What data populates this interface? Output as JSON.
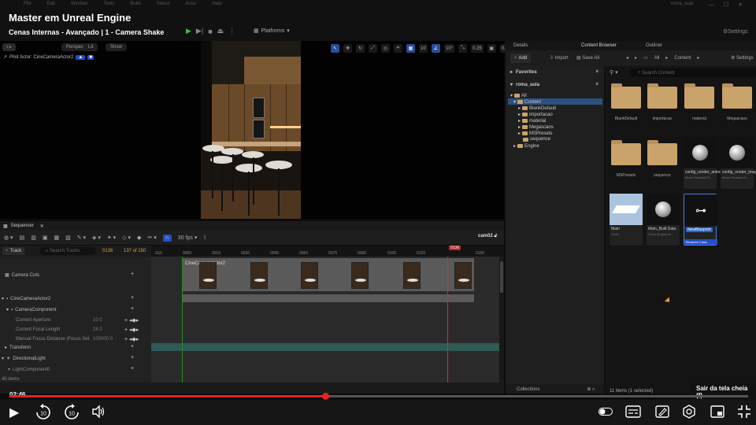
{
  "menu": [
    "File",
    "Edit",
    "Window",
    "Tools",
    "Build",
    "Select",
    "Actor",
    "Help"
  ],
  "project_name": "roma_aula",
  "course_title": "Master em Unreal Engine",
  "lesson_title": "Cenas Internas - Avançado | 1 - Camera Shake",
  "platforms_label": "Platforms",
  "settings_label": "Settings",
  "viewport": {
    "perspective": "Perspective",
    "lit": "Lit",
    "show": "Show",
    "pilot_label": "Pilot Actor: CineCameraActor2",
    "snap_grid": "10",
    "snap_angle": "10°",
    "snap_scale": "0.25",
    "camera_speed": "0.1"
  },
  "sequencer": {
    "tab": "Sequencer",
    "fps": "30 fps",
    "camera_name": "cam02",
    "track_button": "Track",
    "search_placeholder": "Search Tracks",
    "current_frame": "0136",
    "frame_total": "137 of 150",
    "ruler_ticks": [
      "-015",
      "0000",
      "0015",
      "0030",
      "0045",
      "0060",
      "0075",
      "0090",
      "0105",
      "0120",
      "0150"
    ],
    "playhead": "0136",
    "tracks": {
      "camera_cuts": "Camera Cuts",
      "actor": "CineCameraActor2",
      "component": "CameraComponent",
      "aperture": "Current Aperture",
      "aperture_val": "10.0",
      "focal": "Current Focal Length",
      "focal_val": "24.0",
      "focus": "Manual Focus Distance (Focus Set",
      "focus_val": "100000.0",
      "transform": "Transform",
      "light": "DirectionalLight",
      "light_comp": "LightComponent0",
      "items": "40 items"
    },
    "cut_clip_label": "CineCameraActor2"
  },
  "right_tabs": [
    "Details",
    "Content Browser",
    "Outliner"
  ],
  "content_browser": {
    "add": "Add",
    "import": "Import",
    "save_all": "Save All",
    "breadcrumb": [
      "All",
      "Content"
    ],
    "settings": "Settings",
    "favorites": "Favorites",
    "project_root": "roma_aula",
    "search_placeholder": "Search Content",
    "tree": [
      "All",
      "Content",
      "BlankDefault",
      "importacao",
      "material",
      "Megascans",
      "MSPresets",
      "sequence",
      "Engine"
    ],
    "folders": [
      "BlankDefault",
      "importacao",
      "material",
      "Megascans",
      "MSPresets",
      "sequence"
    ],
    "assets": [
      {
        "name": "config_render_animation",
        "sub": "Movie Pipeline Pr..."
      },
      {
        "name": "config_render_imagem",
        "sub": "Movie Pipeline Pr..."
      },
      {
        "name": "Main",
        "sub": "Level"
      },
      {
        "name": "Main_Built Data",
        "sub": "Cloud Engine M..."
      },
      {
        "name": "NewBlueprint",
        "sub": "Blueprint Class"
      }
    ],
    "collections": "Collections",
    "items_count": "11 items (1 selected)"
  },
  "video": {
    "time": "02:46",
    "progress": 0.428,
    "exit_fullscreen": "Sair da tela cheia (f)"
  },
  "colors": {
    "accent_blue": "#2250c8",
    "playhead_red": "#c33333",
    "progress_red": "#e62222",
    "folder": "#c9a36a"
  }
}
